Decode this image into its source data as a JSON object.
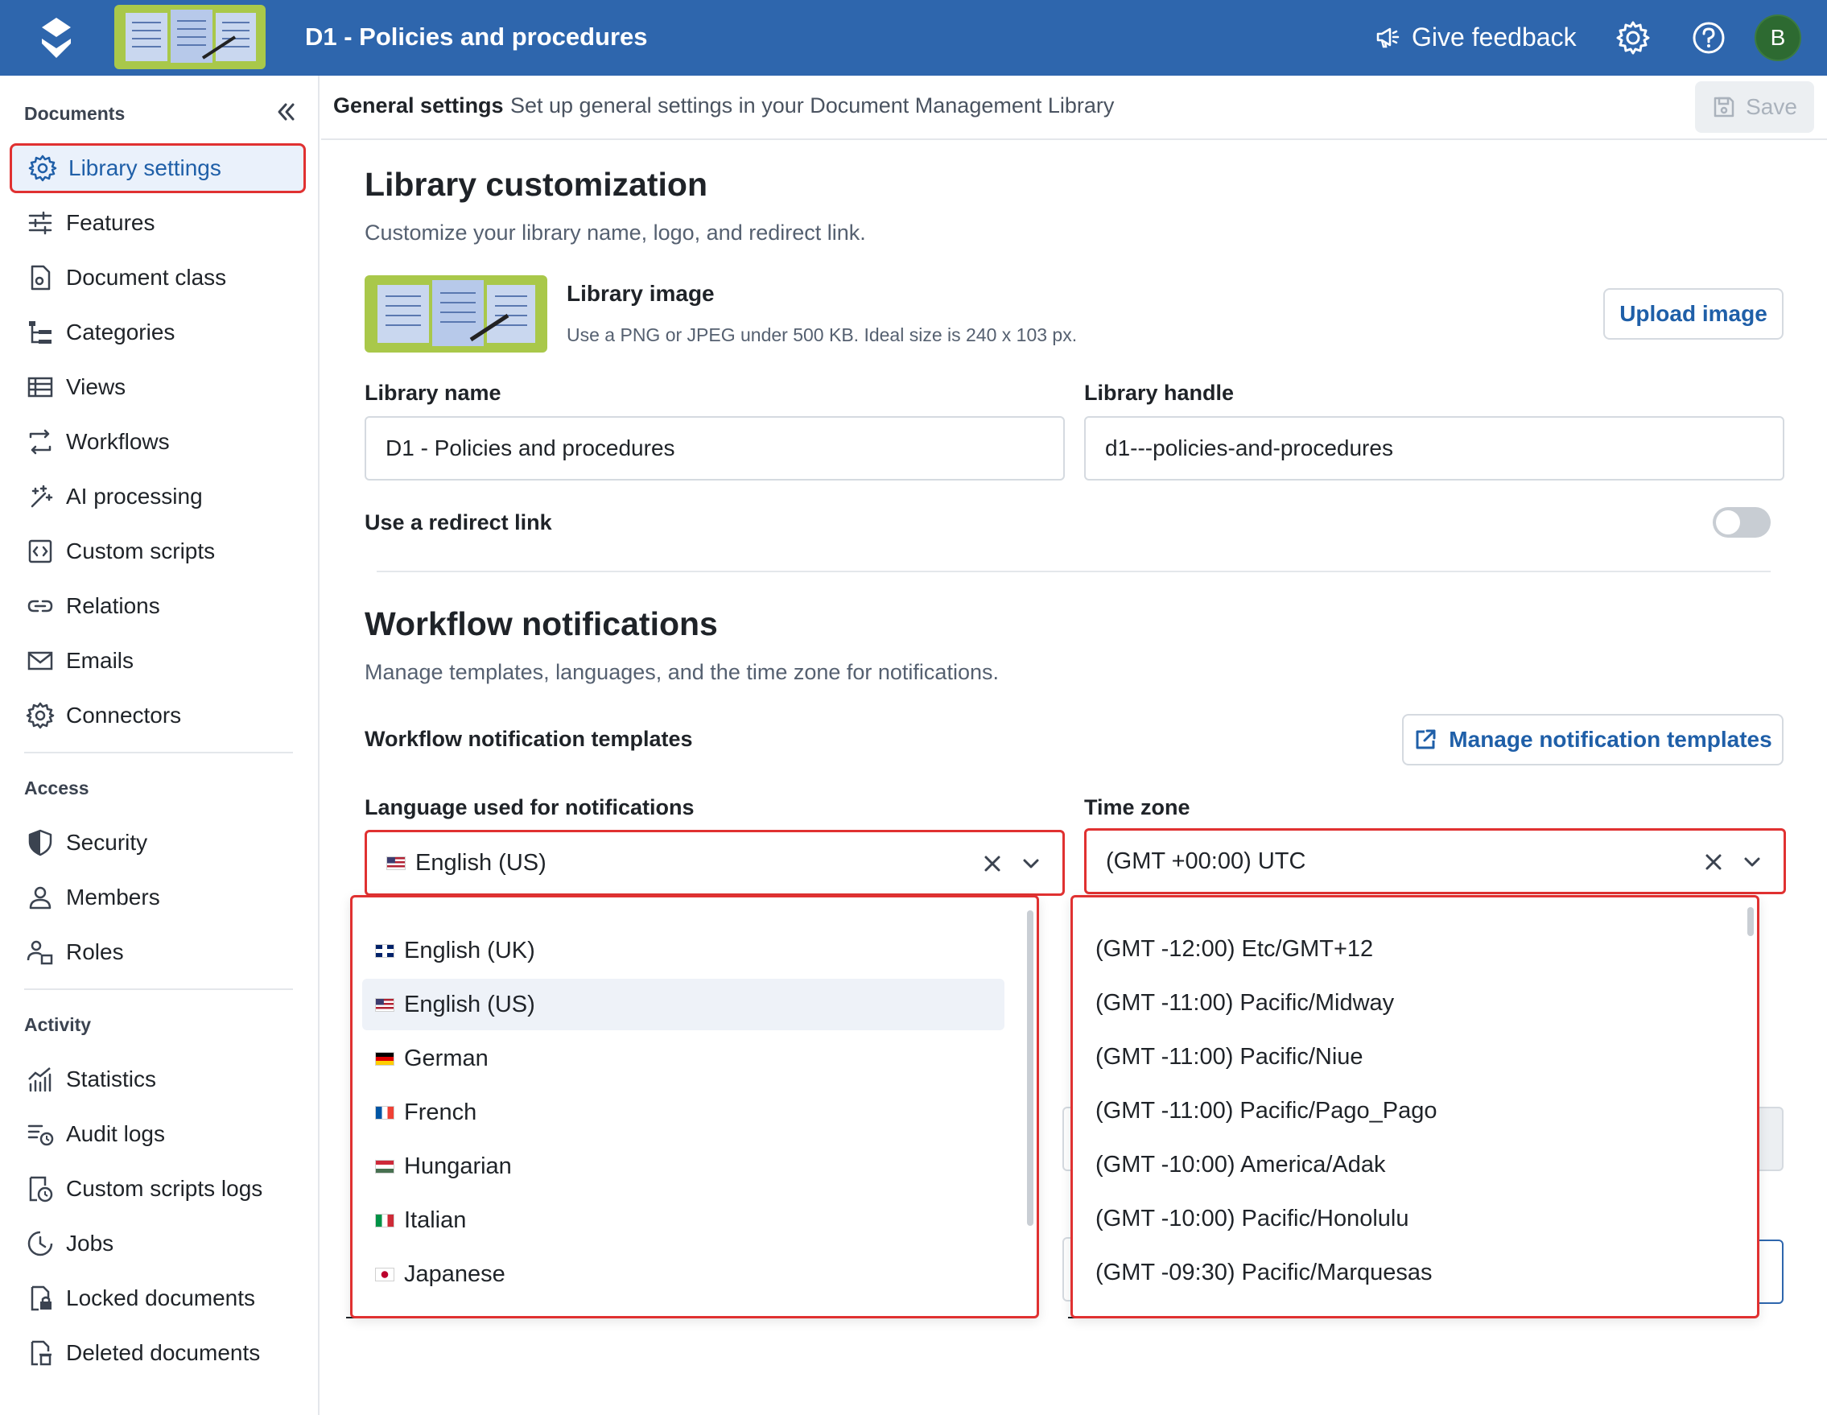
{
  "topbar": {
    "title": "D1 - Policies and procedures",
    "feedback_label": "Give feedback",
    "avatar_initial": "B"
  },
  "sidebar": {
    "documents_heading": "Documents",
    "documents_items": [
      {
        "label": "Library settings",
        "icon": "gear-icon",
        "active": true
      },
      {
        "label": "Features",
        "icon": "sliders-icon"
      },
      {
        "label": "Document class",
        "icon": "document-gear-icon"
      },
      {
        "label": "Categories",
        "icon": "hierarchy-icon"
      },
      {
        "label": "Views",
        "icon": "table-icon"
      },
      {
        "label": "Workflows",
        "icon": "workflow-icon"
      },
      {
        "label": "AI processing",
        "icon": "sparkle-icon"
      },
      {
        "label": "Custom scripts",
        "icon": "code-icon"
      },
      {
        "label": "Relations",
        "icon": "link-icon"
      },
      {
        "label": "Emails",
        "icon": "mail-icon"
      },
      {
        "label": "Connectors",
        "icon": "gear-icon"
      }
    ],
    "access_heading": "Access",
    "access_items": [
      {
        "label": "Security",
        "icon": "shield-icon"
      },
      {
        "label": "Members",
        "icon": "person-icon"
      },
      {
        "label": "Roles",
        "icon": "roles-icon"
      }
    ],
    "activity_heading": "Activity",
    "activity_items": [
      {
        "label": "Statistics",
        "icon": "chart-icon"
      },
      {
        "label": "Audit logs",
        "icon": "list-clock-icon"
      },
      {
        "label": "Custom scripts logs",
        "icon": "script-log-icon"
      },
      {
        "label": "Jobs",
        "icon": "clock-icon"
      },
      {
        "label": "Locked documents",
        "icon": "lock-document-icon"
      },
      {
        "label": "Deleted documents",
        "icon": "trash-document-icon"
      }
    ]
  },
  "header": {
    "title": "General settings",
    "subtitle": "Set up general settings in your Document Management Library",
    "save_label": "Save"
  },
  "customization": {
    "title": "Library customization",
    "description": "Customize your library name, logo, and redirect link.",
    "image_title": "Library image",
    "image_hint": "Use a PNG or JPEG under 500 KB. Ideal size is 240 x 103 px.",
    "upload_label": "Upload image",
    "name_label": "Library name",
    "name_value": "D1 - Policies and procedures",
    "handle_label": "Library handle",
    "handle_value": "d1---policies-and-procedures",
    "redirect_label": "Use a redirect link"
  },
  "notifications": {
    "title": "Workflow notifications",
    "description": "Manage templates, languages, and the time zone for notifications.",
    "templates_label": "Workflow notification templates",
    "manage_label": "Manage notification templates",
    "language_label": "Language used for notifications",
    "language_value": "English (US)",
    "language_options": [
      {
        "label": "English (UK)",
        "flag": "uk"
      },
      {
        "label": "English (US)",
        "flag": "us",
        "selected": true
      },
      {
        "label": "German",
        "flag": "de"
      },
      {
        "label": "French",
        "flag": "fr"
      },
      {
        "label": "Hungarian",
        "flag": "hu"
      },
      {
        "label": "Italian",
        "flag": "it"
      },
      {
        "label": "Japanese",
        "flag": "jp"
      }
    ],
    "timezone_label": "Time zone",
    "timezone_value": "(GMT +00:00) UTC",
    "timezone_options": [
      "(GMT -12:00) Etc/GMT+12",
      "(GMT -11:00) Pacific/Midway",
      "(GMT -11:00) Pacific/Niue",
      "(GMT -11:00) Pacific/Pago_Pago",
      "(GMT -10:00) America/Adak",
      "(GMT -10:00) Pacific/Honolulu",
      "(GMT -09:30) Pacific/Marquesas"
    ]
  },
  "colors": {
    "brand": "#2e66ad",
    "highlight": "#e03131",
    "link": "#1f5fa8"
  }
}
